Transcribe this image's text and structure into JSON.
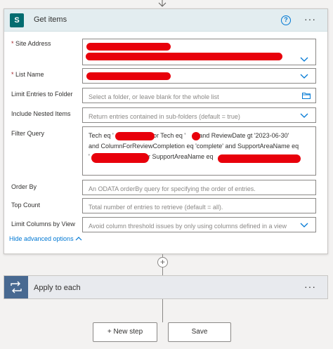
{
  "action": {
    "title": "Get items",
    "icon": "sharepoint-icon",
    "help": "?",
    "more": "···"
  },
  "fields": {
    "site_address": {
      "label": "Site Address",
      "required": "*"
    },
    "list_name": {
      "label": "List Name",
      "required": "*"
    },
    "limit_entries": {
      "label": "Limit Entries to Folder",
      "placeholder": "Select a folder, or leave blank for the whole list"
    },
    "nested_items": {
      "label": "Include Nested Items",
      "placeholder": "Return entries contained in sub-folders (default = true)"
    },
    "filter_query": {
      "label": "Filter Query",
      "line1_a": "Tech eq '",
      "line1_b": "' or Tech eq '",
      "line1_c": "0' and ReviewDate gt '2023-06-30'",
      "line2": "and ColumnForReviewCompletion eq 'complete' and SupportAreaName eq",
      "line3_a": "'",
      "line3_b": "' or SupportAreaName eq"
    },
    "order_by": {
      "label": "Order By",
      "placeholder": "An ODATA orderBy query for specifying the order of entries."
    },
    "top_count": {
      "label": "Top Count",
      "placeholder": "Total number of entries to retrieve (default = all)."
    },
    "limit_columns": {
      "label": "Limit Columns by View",
      "placeholder": "Avoid column threshold issues by only using columns defined in a view"
    }
  },
  "hide_advanced": "Hide advanced options",
  "connector": {
    "plus": "+"
  },
  "apply_each": {
    "title": "Apply to each",
    "more": "···"
  },
  "buttons": {
    "new_step": "+ New step",
    "save": "Save"
  },
  "colors": {
    "accent": "#0078d4",
    "header_bg": "#e3edf0",
    "sharepoint": "#036c70",
    "loop": "#486991",
    "redaction": "#e8000b"
  }
}
